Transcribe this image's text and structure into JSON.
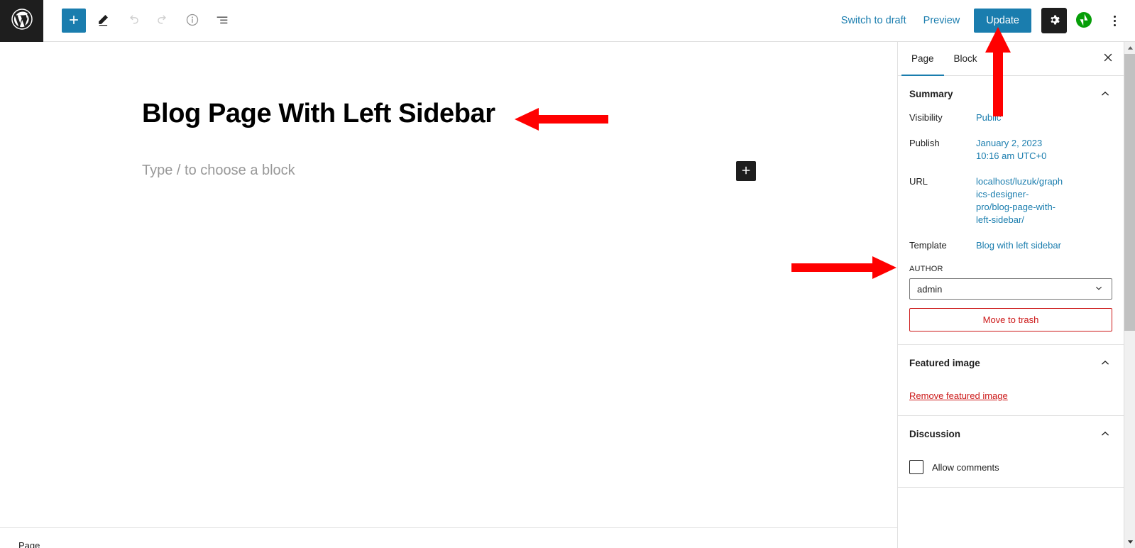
{
  "toolbar": {
    "logo_icon": "wordpress-logo-icon",
    "left_buttons": [
      {
        "name": "block-inserter-button",
        "icon": "plus-icon",
        "label": "Toggle block inserter"
      },
      {
        "name": "edit-mode-button",
        "icon": "pencil-icon",
        "label": "Tools"
      },
      {
        "name": "undo-button",
        "icon": "undo-icon",
        "label": "Undo",
        "disabled": true
      },
      {
        "name": "redo-button",
        "icon": "redo-icon",
        "label": "Redo",
        "disabled": true
      },
      {
        "name": "details-button",
        "icon": "info-circle-icon",
        "label": "Details"
      },
      {
        "name": "list-view-button",
        "icon": "list-view-icon",
        "label": "List View"
      }
    ],
    "switch_to_draft_label": "Switch to draft",
    "preview_label": "Preview",
    "update_label": "Update",
    "settings_icon": "gear-icon",
    "jetpack_icon": "jetpack-icon",
    "more_menu_icon": "kebab-menu-icon",
    "accent_color": "#1a7dae",
    "dark_color": "#1e1e1e",
    "jetpack_color": "#069e08"
  },
  "canvas": {
    "post_title": "Blog Page With Left Sidebar",
    "block_placeholder": "Type / to choose a block",
    "appender_icon": "plus-icon"
  },
  "breadcrumb": {
    "label": "Page"
  },
  "sidebar": {
    "tabs": [
      {
        "label": "Page",
        "active": true
      },
      {
        "label": "Block",
        "active": false
      }
    ],
    "close_icon": "close-icon",
    "panels": [
      {
        "title": "Summary",
        "chevron_icon": "chevron-up-icon",
        "rows": [
          {
            "label": "Visibility",
            "value": "Public"
          },
          {
            "label": "Publish",
            "value": "January 2, 2023 10:16 am UTC+0"
          },
          {
            "label": "URL",
            "value": "localhost/luzuk/graphics-designer-pro/blog-page-with-left-sidebar/"
          },
          {
            "label": "Template",
            "value": "Blog with left sidebar"
          }
        ],
        "author_label": "AUTHOR",
        "author_value": "admin",
        "author_chevron_icon": "chevron-down-icon",
        "trash_label": "Move to trash"
      },
      {
        "title": "Featured image",
        "chevron_icon": "chevron-up-icon",
        "remove_label": "Remove featured image"
      },
      {
        "title": "Discussion",
        "chevron_icon": "chevron-up-icon",
        "checkbox_label": "Allow comments",
        "checkbox_checked": false
      }
    ]
  },
  "scrollbar": {
    "up_icon": "scroll-up-arrow-icon",
    "down_icon": "scroll-down-arrow-icon",
    "thumb": "scroll-thumb"
  },
  "annotations": {
    "color": "#ff0000",
    "arrows": [
      {
        "name": "annotation-arrow-title",
        "direction": "left",
        "target": "post-title"
      },
      {
        "name": "annotation-arrow-update",
        "direction": "up",
        "target": "update-button"
      },
      {
        "name": "annotation-arrow-template",
        "direction": "right",
        "target": "template-row"
      }
    ]
  }
}
